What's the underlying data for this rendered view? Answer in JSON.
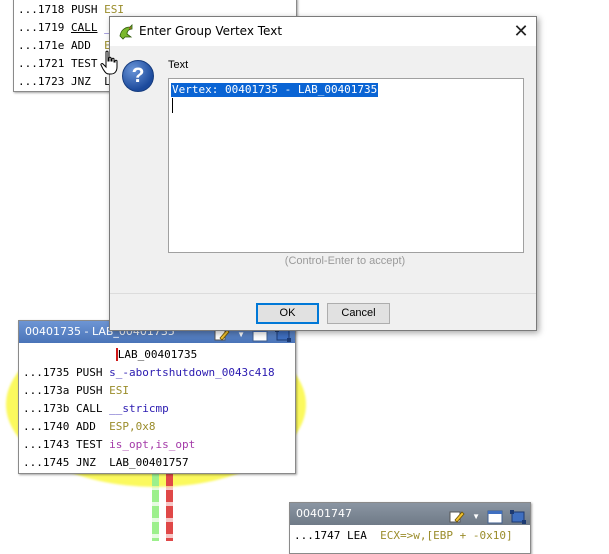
{
  "dialog": {
    "title": "Enter Group Vertex Text",
    "close_glyph": "✕",
    "field_label": "Text",
    "text_value": "Vertex: 00401735 - LAB_00401735",
    "hint": "(Control-Enter to accept)",
    "ok_label": "OK",
    "cancel_label": "Cancel",
    "icon": "question-icon",
    "title_icon": "ghidra-dragon-icon"
  },
  "top_vertex": {
    "rows": [
      {
        "addr": "...1718",
        "mn": "PUSH",
        "op": "ESI"
      },
      {
        "addr": "...1719",
        "mn": "CALL",
        "op": "_"
      },
      {
        "addr": "...171e",
        "mn": "ADD",
        "op": "E"
      },
      {
        "addr": "...1721",
        "mn": "TEST",
        "op": ""
      },
      {
        "addr": "...1723",
        "mn": "JNZ",
        "op": "L"
      }
    ]
  },
  "main_vertex": {
    "title": "00401735 - LAB_00401735",
    "label": "LAB_00401735",
    "rows": [
      {
        "addr": "...1735",
        "mn": "PUSH",
        "op": "s_-abortshutdown_0043c418"
      },
      {
        "addr": "...173a",
        "mn": "PUSH",
        "op": "ESI"
      },
      {
        "addr": "...173b",
        "mn": "CALL",
        "op": "__stricmp"
      },
      {
        "addr": "...1740",
        "mn": "ADD",
        "op": "ESP,0x8"
      },
      {
        "addr": "...1743",
        "mn": "TEST",
        "op": "is_opt,is_opt"
      },
      {
        "addr": "...1745",
        "mn": "JNZ",
        "op": "LAB_00401757"
      }
    ]
  },
  "bottom_vertex": {
    "title": "00401747",
    "rows": [
      {
        "addr": "...1747",
        "mn": "LEA",
        "op": "ECX=>w,[EBP + -0x10]"
      }
    ]
  },
  "colors": {
    "header_blue": "#5a84c6",
    "header_gray": "#7d8894",
    "highlight_yellow": "#fbf95e",
    "edge_green": "#9cf08c",
    "edge_red": "#e04848",
    "selection": "#0a64d4"
  }
}
